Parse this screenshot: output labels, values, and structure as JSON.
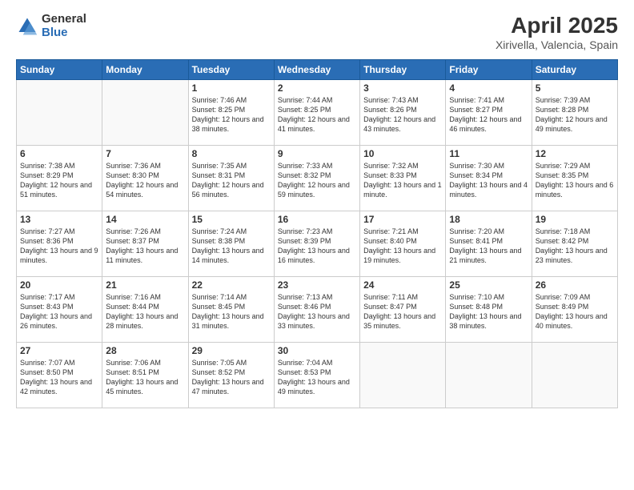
{
  "header": {
    "logo_general": "General",
    "logo_blue": "Blue",
    "month_title": "April 2025",
    "location": "Xirivella, Valencia, Spain"
  },
  "days_of_week": [
    "Sunday",
    "Monday",
    "Tuesday",
    "Wednesday",
    "Thursday",
    "Friday",
    "Saturday"
  ],
  "weeks": [
    [
      {
        "day": "",
        "empty": true
      },
      {
        "day": "",
        "empty": true
      },
      {
        "day": "1",
        "sunrise": "7:46 AM",
        "sunset": "8:25 PM",
        "daylight": "12 hours and 38 minutes."
      },
      {
        "day": "2",
        "sunrise": "7:44 AM",
        "sunset": "8:25 PM",
        "daylight": "12 hours and 41 minutes."
      },
      {
        "day": "3",
        "sunrise": "7:43 AM",
        "sunset": "8:26 PM",
        "daylight": "12 hours and 43 minutes."
      },
      {
        "day": "4",
        "sunrise": "7:41 AM",
        "sunset": "8:27 PM",
        "daylight": "12 hours and 46 minutes."
      },
      {
        "day": "5",
        "sunrise": "7:39 AM",
        "sunset": "8:28 PM",
        "daylight": "12 hours and 49 minutes."
      }
    ],
    [
      {
        "day": "6",
        "sunrise": "7:38 AM",
        "sunset": "8:29 PM",
        "daylight": "12 hours and 51 minutes."
      },
      {
        "day": "7",
        "sunrise": "7:36 AM",
        "sunset": "8:30 PM",
        "daylight": "12 hours and 54 minutes."
      },
      {
        "day": "8",
        "sunrise": "7:35 AM",
        "sunset": "8:31 PM",
        "daylight": "12 hours and 56 minutes."
      },
      {
        "day": "9",
        "sunrise": "7:33 AM",
        "sunset": "8:32 PM",
        "daylight": "12 hours and 59 minutes."
      },
      {
        "day": "10",
        "sunrise": "7:32 AM",
        "sunset": "8:33 PM",
        "daylight": "13 hours and 1 minute."
      },
      {
        "day": "11",
        "sunrise": "7:30 AM",
        "sunset": "8:34 PM",
        "daylight": "13 hours and 4 minutes."
      },
      {
        "day": "12",
        "sunrise": "7:29 AM",
        "sunset": "8:35 PM",
        "daylight": "13 hours and 6 minutes."
      }
    ],
    [
      {
        "day": "13",
        "sunrise": "7:27 AM",
        "sunset": "8:36 PM",
        "daylight": "13 hours and 9 minutes."
      },
      {
        "day": "14",
        "sunrise": "7:26 AM",
        "sunset": "8:37 PM",
        "daylight": "13 hours and 11 minutes."
      },
      {
        "day": "15",
        "sunrise": "7:24 AM",
        "sunset": "8:38 PM",
        "daylight": "13 hours and 14 minutes."
      },
      {
        "day": "16",
        "sunrise": "7:23 AM",
        "sunset": "8:39 PM",
        "daylight": "13 hours and 16 minutes."
      },
      {
        "day": "17",
        "sunrise": "7:21 AM",
        "sunset": "8:40 PM",
        "daylight": "13 hours and 19 minutes."
      },
      {
        "day": "18",
        "sunrise": "7:20 AM",
        "sunset": "8:41 PM",
        "daylight": "13 hours and 21 minutes."
      },
      {
        "day": "19",
        "sunrise": "7:18 AM",
        "sunset": "8:42 PM",
        "daylight": "13 hours and 23 minutes."
      }
    ],
    [
      {
        "day": "20",
        "sunrise": "7:17 AM",
        "sunset": "8:43 PM",
        "daylight": "13 hours and 26 minutes."
      },
      {
        "day": "21",
        "sunrise": "7:16 AM",
        "sunset": "8:44 PM",
        "daylight": "13 hours and 28 minutes."
      },
      {
        "day": "22",
        "sunrise": "7:14 AM",
        "sunset": "8:45 PM",
        "daylight": "13 hours and 31 minutes."
      },
      {
        "day": "23",
        "sunrise": "7:13 AM",
        "sunset": "8:46 PM",
        "daylight": "13 hours and 33 minutes."
      },
      {
        "day": "24",
        "sunrise": "7:11 AM",
        "sunset": "8:47 PM",
        "daylight": "13 hours and 35 minutes."
      },
      {
        "day": "25",
        "sunrise": "7:10 AM",
        "sunset": "8:48 PM",
        "daylight": "13 hours and 38 minutes."
      },
      {
        "day": "26",
        "sunrise": "7:09 AM",
        "sunset": "8:49 PM",
        "daylight": "13 hours and 40 minutes."
      }
    ],
    [
      {
        "day": "27",
        "sunrise": "7:07 AM",
        "sunset": "8:50 PM",
        "daylight": "13 hours and 42 minutes."
      },
      {
        "day": "28",
        "sunrise": "7:06 AM",
        "sunset": "8:51 PM",
        "daylight": "13 hours and 45 minutes."
      },
      {
        "day": "29",
        "sunrise": "7:05 AM",
        "sunset": "8:52 PM",
        "daylight": "13 hours and 47 minutes."
      },
      {
        "day": "30",
        "sunrise": "7:04 AM",
        "sunset": "8:53 PM",
        "daylight": "13 hours and 49 minutes."
      },
      {
        "day": "",
        "empty": true
      },
      {
        "day": "",
        "empty": true
      },
      {
        "day": "",
        "empty": true
      }
    ]
  ]
}
